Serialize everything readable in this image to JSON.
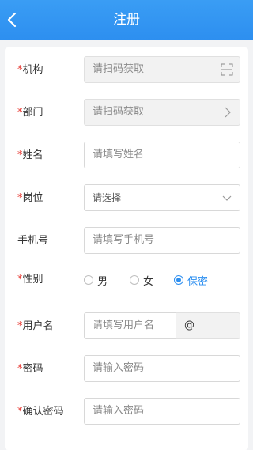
{
  "header": {
    "title": "注册"
  },
  "form": {
    "org": {
      "label": "机构",
      "placeholder": "请扫码获取"
    },
    "dept": {
      "label": "部门",
      "placeholder": "请扫码获取"
    },
    "name": {
      "label": "姓名",
      "placeholder": "请填写姓名"
    },
    "position": {
      "label": "岗位",
      "placeholder": "请选择"
    },
    "phone": {
      "label": "手机号",
      "placeholder": "请填写手机号"
    },
    "gender": {
      "label": "性别",
      "options": [
        "男",
        "女",
        "保密"
      ],
      "selected": "保密"
    },
    "username": {
      "label": "用户名",
      "placeholder": "请填写用户名",
      "suffix": "@"
    },
    "password": {
      "label": "密码",
      "placeholder": "请输入密码"
    },
    "confirm": {
      "label": "确认密码",
      "placeholder": "请输入密码"
    },
    "required_mark": "*"
  },
  "colors": {
    "accent": "#2d8ff0",
    "required": "#e6322b"
  }
}
